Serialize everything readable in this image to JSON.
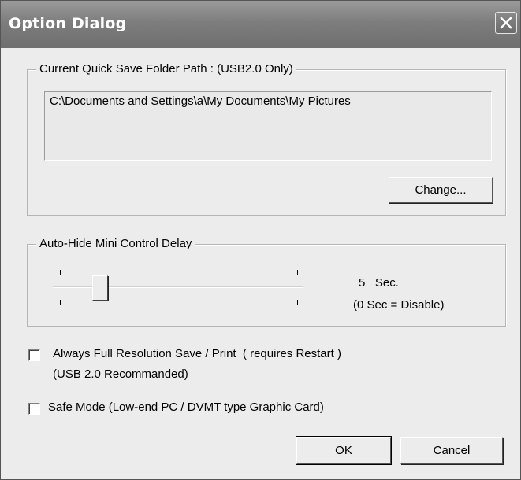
{
  "window": {
    "title": "Option Dialog",
    "close_icon": "close-icon"
  },
  "quick_save": {
    "legend": "Current Quick Save Folder Path : (USB2.0 Only)",
    "path": "C:\\Documents and Settings\\a\\My Documents\\My Pictures",
    "change_label": "Change..."
  },
  "auto_hide": {
    "legend": "Auto-Hide Mini Control Delay",
    "slider_value": 5,
    "value_text": "5   Sec.",
    "note": "(0 Sec = Disable)"
  },
  "options": {
    "full_resolution_label": "Always Full Resolution Save / Print  ( requires Restart )",
    "full_resolution_sub": "(USB 2.0 Recommanded)",
    "full_resolution_checked": false,
    "safe_mode_label": "Safe Mode (Low-end PC / DVMT type Graphic Card)",
    "safe_mode_checked": false
  },
  "buttons": {
    "ok_label": "OK",
    "cancel_label": "Cancel"
  }
}
